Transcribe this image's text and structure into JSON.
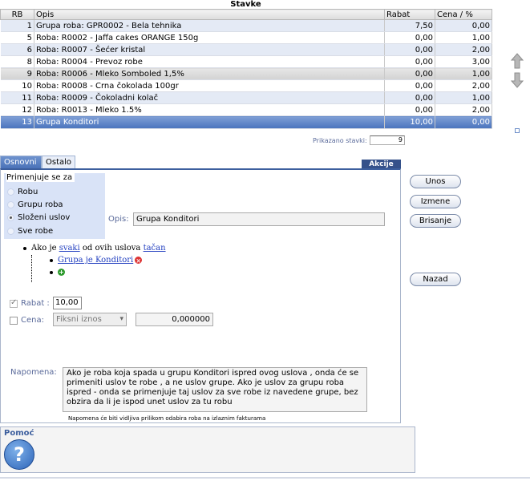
{
  "table": {
    "title": "Stavke",
    "columns": {
      "rb": "RB",
      "opis": "Opis",
      "rabat": "Rabat",
      "cena": "Cena / %"
    },
    "rows": [
      {
        "rb": "1",
        "opis": "Grupa roba: GPR0002 - Bela tehnika",
        "rabat": "7,50",
        "cena": "0,00"
      },
      {
        "rb": "5",
        "opis": "Roba: R0002 - Jaffa cakes ORANGE 150g",
        "rabat": "0,00",
        "cena": "1,00"
      },
      {
        "rb": "6",
        "opis": "Roba: R0007 - Šećer kristal",
        "rabat": "0,00",
        "cena": "2,00"
      },
      {
        "rb": "8",
        "opis": "Roba: R0004 - Prevoz robe",
        "rabat": "0,00",
        "cena": "3,00"
      },
      {
        "rb": "9",
        "opis": "Roba: R0006 - Mleko Somboled 1,5%",
        "rabat": "0,00",
        "cena": "1,00"
      },
      {
        "rb": "10",
        "opis": "Roba: R0008 - Crna čokolada 100gr",
        "rabat": "0,00",
        "cena": "2,00"
      },
      {
        "rb": "11",
        "opis": "Roba: R0009 - Čokoladni kolač",
        "rabat": "0,00",
        "cena": "1,00"
      },
      {
        "rb": "12",
        "opis": "Roba: R0013 - Mleko 1.5%",
        "rabat": "0,00",
        "cena": "2,00"
      },
      {
        "rb": "13",
        "opis": "Grupa Konditori",
        "rabat": "10,00",
        "cena": "0,00"
      }
    ],
    "count_label": "Prikazano stavki:",
    "count_value": "9"
  },
  "tabs": {
    "osnovni": "Osnovni",
    "ostalo": "Ostalo"
  },
  "akcije": "Akcije",
  "apply": {
    "title": "Primenjuje se za",
    "options": [
      "Robu",
      "Grupu roba",
      "Složeni uslov",
      "Sve robe"
    ],
    "selected": "Složeni uslov"
  },
  "opis": {
    "label": "Opis:",
    "value": "Grupa Konditori"
  },
  "condition": {
    "prefix": "Ako je",
    "quantifier": "svaki",
    "middle": "od ovih uslova",
    "truth": "tačan",
    "item": "Grupa je Konditori"
  },
  "rabat": {
    "label": "Rabat :",
    "value": "10,00"
  },
  "cena": {
    "label": "Cena:",
    "select_value": "Fiksni iznos",
    "value": "0,000000"
  },
  "note": {
    "label": "Napomena:",
    "text": "Ako je roba koja spada u grupu Konditori ispred ovog uslova , onda će se primeniti uslov te  robe , a ne uslov grupe. Ako  je uslov za grupu roba ispred - onda se  primenjuje  taj uslov za sve robe iz navedene grupe, bez obzira da li je ispod unet uslov za tu  robu",
    "hint": "Napomena će biti vidljiva prilikom odabira roba na izlaznim fakturama"
  },
  "buttons": {
    "unos": "Unos",
    "izmene": "Izmene",
    "brisanje": "Brisanje",
    "nazad": "Nazad"
  },
  "help": {
    "title": "Pomoć",
    "icon": "?"
  }
}
